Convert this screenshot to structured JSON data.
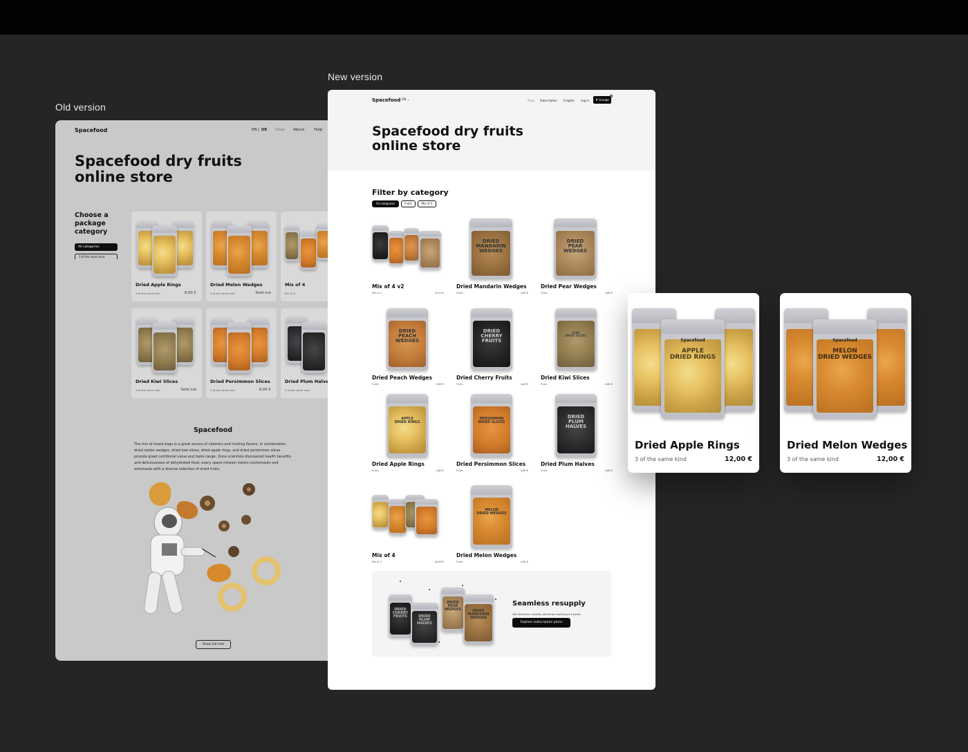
{
  "captions": {
    "old": "Old version",
    "new": "New version"
  },
  "old": {
    "brand": "Spacefood",
    "lang": {
      "en": "EN",
      "sep": "|",
      "de": "DE"
    },
    "nav": [
      "Shop",
      "About",
      "Help"
    ],
    "title": "Spacefood dry fruits online store",
    "choose": "Choose a package category",
    "pills": [
      "All categories",
      "3 of the same kind"
    ],
    "products": [
      {
        "name": "Dried Apple Rings",
        "sub": "3 of the same kind",
        "price": "9,00 €"
      },
      {
        "name": "Dried Melon Wedges",
        "sub": "3 of the same kind",
        "price": "Sold out"
      },
      {
        "name": "Mix of 4",
        "sub": "Mix of 4",
        "price": ""
      },
      {
        "name": "Dried Kiwi Slices",
        "sub": "3 of the same kind",
        "price": "Sold out"
      },
      {
        "name": "Dried Persimmon Slices",
        "sub": "3 of the same kind",
        "price": "9,00 €"
      },
      {
        "name": "Dried Plum Halves",
        "sub": "3 of the same kind",
        "price": ""
      }
    ],
    "about_title": "Spacefood",
    "about_text": "The mix of snack bags is a great source of vitamins and inviting flavors. In combination, dried melon wedges, dried kiwi slices, dried apple rings, and dried persimmon slices provide great nutritional value and taste range. Once scientists discovered health benefits and deliciousness of dehydrated food, every space mission stocks cosmonauts and astronauts with a diverse selection of dried fruits.",
    "show_full": "Show full text"
  },
  "new": {
    "brand": "Spacefood",
    "lang": "EN",
    "nav": [
      "Shop",
      "Subscription",
      "Insights",
      "Log in"
    ],
    "garage": "Garage",
    "title": "Spacefood dry fruits online store",
    "filter_title": "Filter by category",
    "filters": [
      "All categories",
      "Fruits",
      "Mix of 4"
    ],
    "products": [
      {
        "name": "Mix of 4 v2",
        "sub": "Mix of 4",
        "price": "19,20 €"
      },
      {
        "name": "Dried Mandarin Wedges",
        "sub": "Fruits",
        "price": "4,80 €"
      },
      {
        "name": "Dried Pear Wedges",
        "sub": "Fruits",
        "price": "4,80 €"
      },
      {
        "name": "Dried Peach Wedges",
        "sub": "Fruits",
        "price": "4,80 €"
      },
      {
        "name": "Dried Cherry Fruits",
        "sub": "Fruits",
        "price": "4,80 €"
      },
      {
        "name": "Dried Kiwi Slices",
        "sub": "Fruits",
        "price": "4,80 €"
      },
      {
        "name": "Dried Apple Rings",
        "sub": "Fruits",
        "price": "4,80 €"
      },
      {
        "name": "Dried Persimmon Slices",
        "sub": "Fruits",
        "price": "4,80 €"
      },
      {
        "name": "Dried Plum Halves",
        "sub": "Fruits",
        "price": "4,80 €"
      },
      {
        "name": "Mix of 4",
        "sub": "Mix of 4",
        "price": "16,00 €"
      },
      {
        "name": "Dried Melon Wedges",
        "sub": "Fruits",
        "price": "4,80 €"
      }
    ],
    "bag_labels": {
      "mandarin": "DRIED\nMANDARIN\nWEDGES",
      "pear": "DRIED\nPEAR\nWEDGES",
      "peach": "DRIED\nPEACH\nWEDGES",
      "cherry": "DRIED\nCHERRY\nFRUITS",
      "plum": "DRIED\nPLUM\nHALVES",
      "apple": "APPLE\nDRIED RINGS",
      "persimmon": "PERSIMMON\nDRIED SLICES",
      "melon": "MELON\nDRIED WEDGES",
      "kiwi": "KIWI\nDRIED SLICES"
    },
    "resupply": {
      "title": "Seamless resupply",
      "text": "Get effortless monthly deliveries starting at 4 packs",
      "button": "Explore subscription plans"
    }
  },
  "featured": [
    {
      "name": "Dried Apple Rings",
      "sub": "3 of the same kind",
      "price": "12,00 €",
      "bag_top": "Spacefood",
      "bag_label": "APPLE\nDRIED RINGS"
    },
    {
      "name": "Dried Melon Wedges",
      "sub": "3 of the same kind",
      "price": "12,00 €",
      "bag_top": "Spacefood",
      "bag_label": "MELON\nDRIED WEDGES"
    }
  ]
}
